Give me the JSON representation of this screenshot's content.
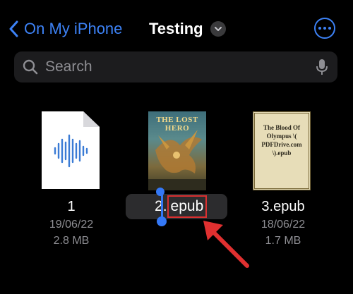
{
  "nav": {
    "back_label": "On My iPhone",
    "title": "Testing"
  },
  "search": {
    "placeholder": "Search"
  },
  "files": [
    {
      "name": "1",
      "date": "19/06/22",
      "size": "2.8 MB",
      "thumbnail": "audio-document-icon"
    },
    {
      "name": "2.epub",
      "date": "",
      "size": "",
      "thumbnail": "book-cover-the-lost-hero",
      "cover_title": "THE LOST HERO"
    },
    {
      "name": "3.epub",
      "date": "18/06/22",
      "size": "1.7 MB",
      "thumbnail": "book-cover-parchment",
      "cover_text": "The Blood Of Olympus \\( PDFDrive.com \\).epub"
    }
  ],
  "rename": {
    "prefix": "2",
    "selected": "epub",
    "separator": "."
  },
  "colors": {
    "accent": "#3d82f6",
    "background": "#000000",
    "field": "#1c1c1e",
    "secondary_text": "#8e8e93",
    "annotation": "#d93030"
  }
}
